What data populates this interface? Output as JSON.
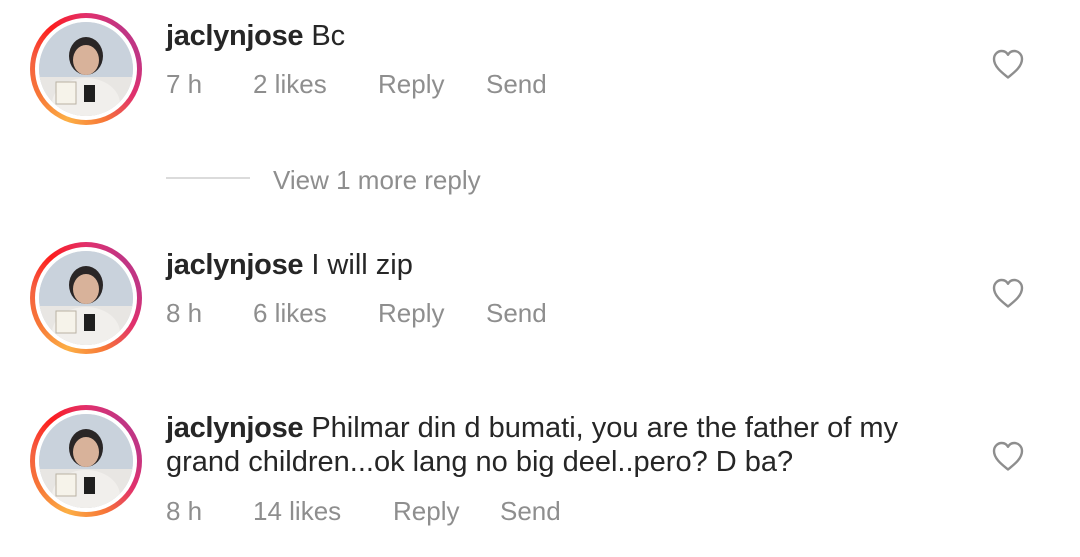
{
  "comments": [
    {
      "username": "jaclynjose",
      "text": "Bc",
      "time": "7 h",
      "likes": "2 likes",
      "reply_label": "Reply",
      "send_label": "Send",
      "icon": "heart-outline-icon"
    },
    {
      "username": "jaclynjose",
      "text": "I will zip",
      "time": "8 h",
      "likes": "6 likes",
      "reply_label": "Reply",
      "send_label": "Send",
      "icon": "heart-outline-icon"
    },
    {
      "username": "jaclynjose",
      "text": "Philmar din d bumati, you are the father of my grand children...ok lang no big deel..pero? D ba?",
      "time": "8 h",
      "likes": "14 likes",
      "reply_label": "Reply",
      "send_label": "Send",
      "icon": "heart-outline-icon"
    }
  ],
  "view_more_replies": "View 1 more reply",
  "colors": {
    "text": "#262626",
    "secondary": "#8e8e8e",
    "divider": "#dbdbdb",
    "story_ring_start": "#fcaf45",
    "story_ring_end": "#c13584"
  }
}
